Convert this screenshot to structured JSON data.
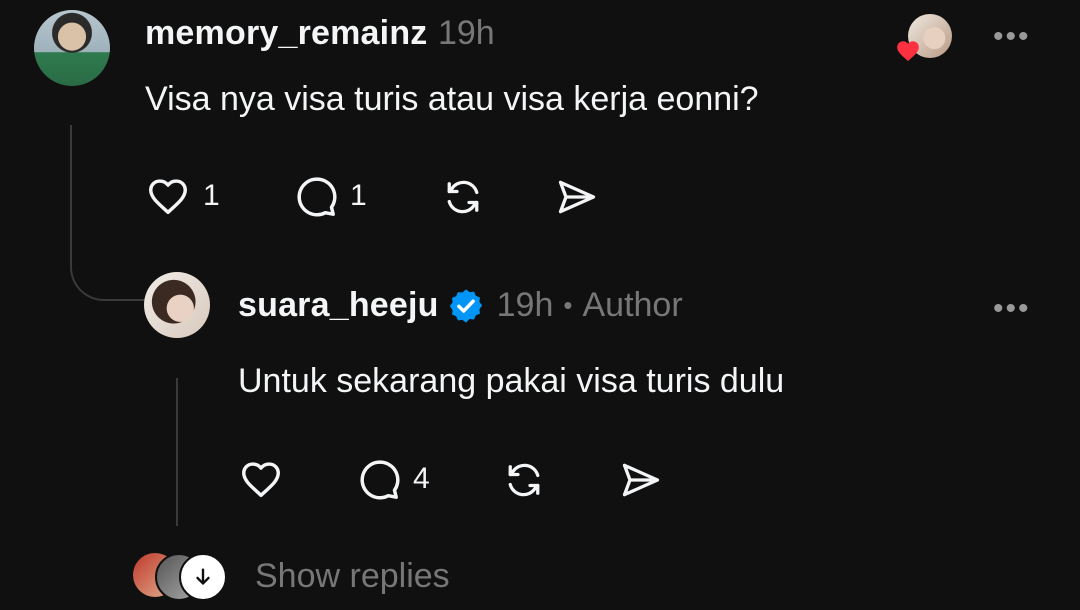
{
  "comment": {
    "username": "memory_remainz",
    "time": "19h",
    "text": "Visa nya visa turis atau visa kerja eonni?",
    "more": "•••",
    "actions": {
      "like_count": "1",
      "reply_count": "1"
    },
    "icons": {
      "like": "heart-icon",
      "reply": "speech-bubble-icon",
      "repost": "repost-icon",
      "share": "send-icon",
      "liked_by": "heart-badge-icon"
    }
  },
  "reply": {
    "username": "suara_heeju",
    "verified": "verified-badge-icon",
    "time": "19h",
    "separator": "•",
    "role": "Author",
    "text": "Untuk sekarang pakai visa turis dulu",
    "more": "•••",
    "actions": {
      "reply_count": "4"
    }
  },
  "footer": {
    "show_replies": "Show replies"
  },
  "colors": {
    "background": "#101010",
    "text_primary": "#f3f5f7",
    "text_secondary": "#777777",
    "verified_blue": "#0095f6",
    "heart_red": "#ff3040"
  }
}
